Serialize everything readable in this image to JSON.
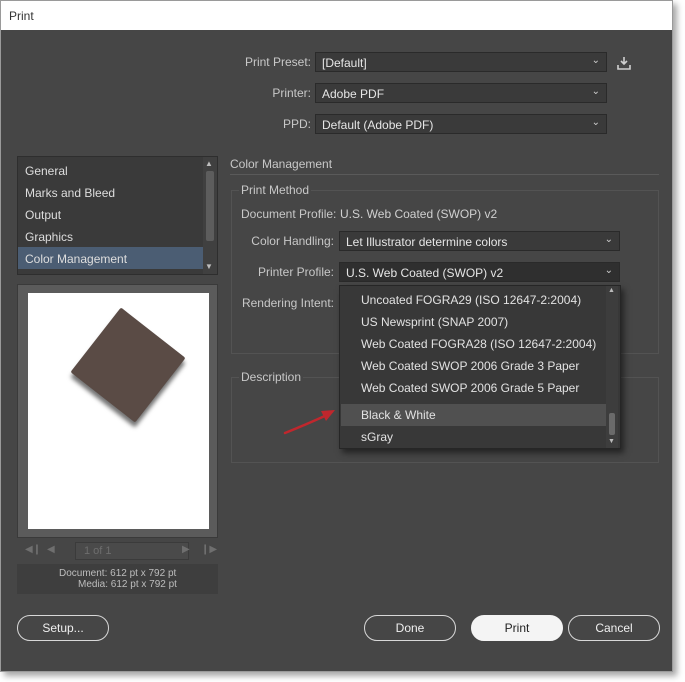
{
  "window": {
    "title": "Print"
  },
  "header": {
    "print_preset": {
      "label": "Print Preset:",
      "value": "[Default]"
    },
    "printer": {
      "label": "Printer:",
      "value": "Adobe PDF"
    },
    "ppd": {
      "label": "PPD:",
      "value": "Default (Adobe PDF)"
    }
  },
  "sidebar": {
    "items": [
      {
        "label": "General"
      },
      {
        "label": "Marks and Bleed"
      },
      {
        "label": "Output"
      },
      {
        "label": "Graphics"
      },
      {
        "label": "Color Management",
        "selected": true
      }
    ]
  },
  "preview": {
    "page_indicator": "1 of 1",
    "document_size": "Document: 612 pt x 792 pt",
    "media_size": "Media: 612 pt x 792 pt"
  },
  "color_management": {
    "section_title": "Color Management",
    "print_method": {
      "group_title": "Print Method",
      "document_profile_label": "Document Profile:",
      "document_profile_value": "U.S. Web Coated (SWOP) v2",
      "color_handling_label": "Color Handling:",
      "color_handling_value": "Let Illustrator determine colors",
      "printer_profile_label": "Printer Profile:",
      "printer_profile_value": "U.S. Web Coated (SWOP) v2",
      "rendering_intent_label": "Rendering Intent:"
    },
    "description": {
      "group_title": "Description"
    }
  },
  "printer_profile_dropdown": {
    "options": [
      {
        "label": "Uncoated FOGRA29 (ISO 12647-2:2004)"
      },
      {
        "label": "US Newsprint (SNAP 2007)"
      },
      {
        "label": "Web Coated FOGRA28 (ISO 12647-2:2004)"
      },
      {
        "label": "Web Coated SWOP 2006 Grade 3 Paper"
      },
      {
        "label": "Web Coated SWOP 2006 Grade 5 Paper"
      },
      {
        "label": "Black & White",
        "highlighted": true
      },
      {
        "label": "sGray"
      }
    ]
  },
  "footer": {
    "setup_label": "Setup...",
    "done_label": "Done",
    "print_label": "Print",
    "cancel_label": "Cancel"
  },
  "colors": {
    "dialog_background": "#464646",
    "selection": "#4b5d73",
    "arrow_annotation": "#c0272d"
  },
  "icons": {
    "save_preset": "download-icon",
    "dropdown": "chevron-down-icon"
  }
}
